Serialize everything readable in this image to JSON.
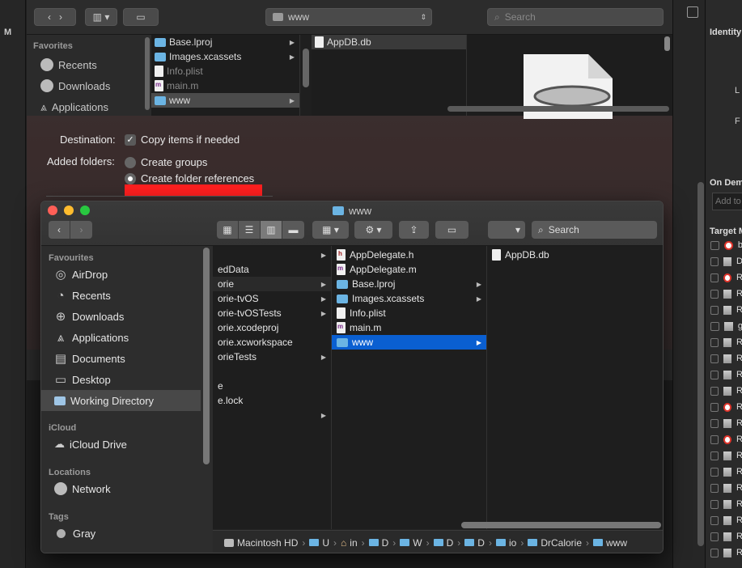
{
  "xcode": {
    "left_letter": "M",
    "inspector": {
      "identity": "Identity",
      "label_l": "L",
      "label_f": "F",
      "on_demand": "On Dema",
      "add_to": "Add to",
      "target_membership": "Target M",
      "target_rows": [
        {
          "icon": "target",
          "letter": "b"
        },
        {
          "icon": "library",
          "letter": "D"
        },
        {
          "icon": "target",
          "letter": "R"
        },
        {
          "icon": "library",
          "letter": "R"
        },
        {
          "icon": "library",
          "letter": "R"
        },
        {
          "icon": "library",
          "letter": "g"
        },
        {
          "icon": "library",
          "letter": "R"
        },
        {
          "icon": "library",
          "letter": "R"
        },
        {
          "icon": "library",
          "letter": "R"
        },
        {
          "icon": "library",
          "letter": "R"
        },
        {
          "icon": "target",
          "letter": "R"
        },
        {
          "icon": "library",
          "letter": "R"
        },
        {
          "icon": "target",
          "letter": "R"
        },
        {
          "icon": "library",
          "letter": "R"
        },
        {
          "icon": "library",
          "letter": "R"
        },
        {
          "icon": "library",
          "letter": "R"
        },
        {
          "icon": "library",
          "letter": "R"
        },
        {
          "icon": "library",
          "letter": "R"
        },
        {
          "icon": "library",
          "letter": "R"
        },
        {
          "icon": "library",
          "letter": "R"
        }
      ]
    }
  },
  "sheet": {
    "location": "www",
    "search_placeholder": "Search",
    "sidebar": {
      "heading": "Favorites",
      "items": [
        "Recents",
        "Downloads",
        "Applications"
      ]
    },
    "col1": [
      {
        "name": "Base.lproj",
        "type": "folder",
        "arrow": true
      },
      {
        "name": "Images.xcassets",
        "type": "folder",
        "arrow": true
      },
      {
        "name": "Info.plist",
        "type": "doc",
        "dim": true
      },
      {
        "name": "main.m",
        "type": "mdoc",
        "dim": true
      },
      {
        "name": "www",
        "type": "folder",
        "arrow": true,
        "selected": true
      }
    ],
    "col2": [
      {
        "name": "AppDB.db",
        "type": "doc"
      }
    ],
    "destination_label": "Destination:",
    "copy_items": "Copy items if needed",
    "added_folders_label": "Added folders:",
    "create_groups": "Create groups",
    "create_folder_refs": "Create folder references",
    "accent_red": "#ff1f1f"
  },
  "finder": {
    "title": "www",
    "search_placeholder": "Search",
    "sidebar": {
      "favourites_heading": "Favourites",
      "favourites": [
        {
          "label": "AirDrop",
          "icon": "airdrop-icon"
        },
        {
          "label": "Recents",
          "icon": "clock-icon"
        },
        {
          "label": "Downloads",
          "icon": "download-icon"
        },
        {
          "label": "Applications",
          "icon": "applications-icon"
        },
        {
          "label": "Documents",
          "icon": "document-icon"
        },
        {
          "label": "Desktop",
          "icon": "desktop-icon"
        },
        {
          "label": "Working Directory",
          "icon": "folder-icon",
          "selected": true
        }
      ],
      "icloud_heading": "iCloud",
      "icloud": [
        {
          "label": "iCloud Drive",
          "icon": "cloud-icon"
        }
      ],
      "locations_heading": "Locations",
      "locations": [
        {
          "label": "Network",
          "icon": "globe-icon"
        }
      ],
      "tags_heading": "Tags",
      "tags": [
        {
          "label": "Gray",
          "color": "#b0b0b0"
        }
      ]
    },
    "col_a": [
      {
        "name": "",
        "arrow": true
      },
      {
        "name": "edData",
        "arrow": false
      },
      {
        "name": "orie",
        "arrow": true,
        "highlighted": true
      },
      {
        "name": "orie-tvOS",
        "arrow": true
      },
      {
        "name": "orie-tvOSTests",
        "arrow": true
      },
      {
        "name": "orie.xcodeproj",
        "arrow": false
      },
      {
        "name": "orie.xcworkspace",
        "arrow": false
      },
      {
        "name": "orieTests",
        "arrow": true
      },
      {
        "name": "",
        "arrow": false
      },
      {
        "name": "e",
        "arrow": false
      },
      {
        "name": "e.lock",
        "arrow": false
      },
      {
        "name": "",
        "arrow": true
      }
    ],
    "col_b": [
      {
        "name": "AppDelegate.h",
        "type": "hdoc"
      },
      {
        "name": "AppDelegate.m",
        "type": "mdoc"
      },
      {
        "name": "Base.lproj",
        "type": "folder",
        "arrow": true
      },
      {
        "name": "Images.xcassets",
        "type": "folder",
        "arrow": true
      },
      {
        "name": "Info.plist",
        "type": "doc"
      },
      {
        "name": "main.m",
        "type": "mdoc"
      },
      {
        "name": "www",
        "type": "folder",
        "arrow": true,
        "selected": true
      }
    ],
    "col_c": [
      {
        "name": "AppDB.db",
        "type": "doc"
      }
    ],
    "path": [
      {
        "label": "Macintosh HD",
        "icon": "disk"
      },
      {
        "label": "U",
        "icon": "users-folder"
      },
      {
        "label": "in",
        "icon": "home"
      },
      {
        "label": "D",
        "icon": "folder"
      },
      {
        "label": "W",
        "icon": "folder"
      },
      {
        "label": "D",
        "icon": "folder"
      },
      {
        "label": "D",
        "icon": "folder"
      },
      {
        "label": "io",
        "icon": "folder"
      },
      {
        "label": "DrCalorie",
        "icon": "folder"
      },
      {
        "label": "www",
        "icon": "folder"
      }
    ],
    "colors": {
      "selection": "#0a5fd1",
      "folder": "#6bb4e3"
    }
  }
}
